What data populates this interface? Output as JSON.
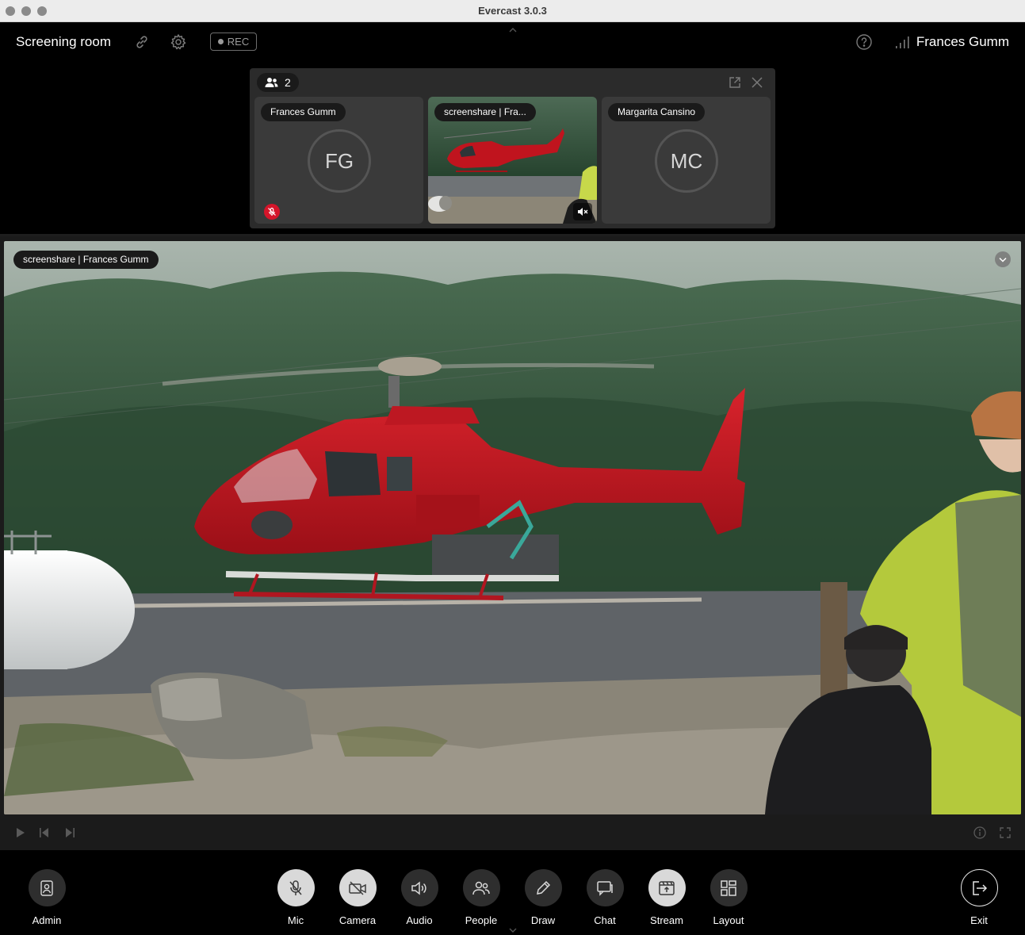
{
  "window": {
    "title": "Evercast 3.0.3",
    "traffic_lights": [
      "close",
      "minimize",
      "zoom"
    ]
  },
  "header": {
    "room_name": "Screening room",
    "icons": [
      "link-icon",
      "gear-icon",
      "help-icon",
      "signal-icon"
    ],
    "rec_label": "REC",
    "user_name": "Frances Gumm"
  },
  "participants_panel": {
    "count": "2",
    "tiles": [
      {
        "label": "Frances Gumm",
        "initials": "FG",
        "mic_muted": true
      },
      {
        "label": "screenshare | Fra...",
        "type": "screenshare",
        "audio_muted": true
      },
      {
        "label": "Margarita Cansino",
        "initials": "MC"
      }
    ]
  },
  "main_video": {
    "label": "screenshare | Frances Gumm"
  },
  "toolbar": {
    "left": {
      "label": "Admin",
      "icon": "admin-icon"
    },
    "center": [
      {
        "label": "Mic",
        "icon": "mic-off-icon",
        "state": "off"
      },
      {
        "label": "Camera",
        "icon": "camera-off-icon",
        "state": "off"
      },
      {
        "label": "Audio",
        "icon": "speaker-icon"
      },
      {
        "label": "People",
        "icon": "people-icon"
      },
      {
        "label": "Draw",
        "icon": "pencil-icon"
      },
      {
        "label": "Chat",
        "icon": "chat-icon"
      },
      {
        "label": "Stream",
        "icon": "stream-icon",
        "state": "active"
      },
      {
        "label": "Layout",
        "icon": "layout-icon"
      }
    ],
    "right": {
      "label": "Exit",
      "icon": "exit-icon"
    }
  },
  "colors": {
    "muted_red": "#d5152a",
    "helicopter_red": "#c0141e",
    "background": "#000000",
    "panel": "#2b2b2b"
  }
}
